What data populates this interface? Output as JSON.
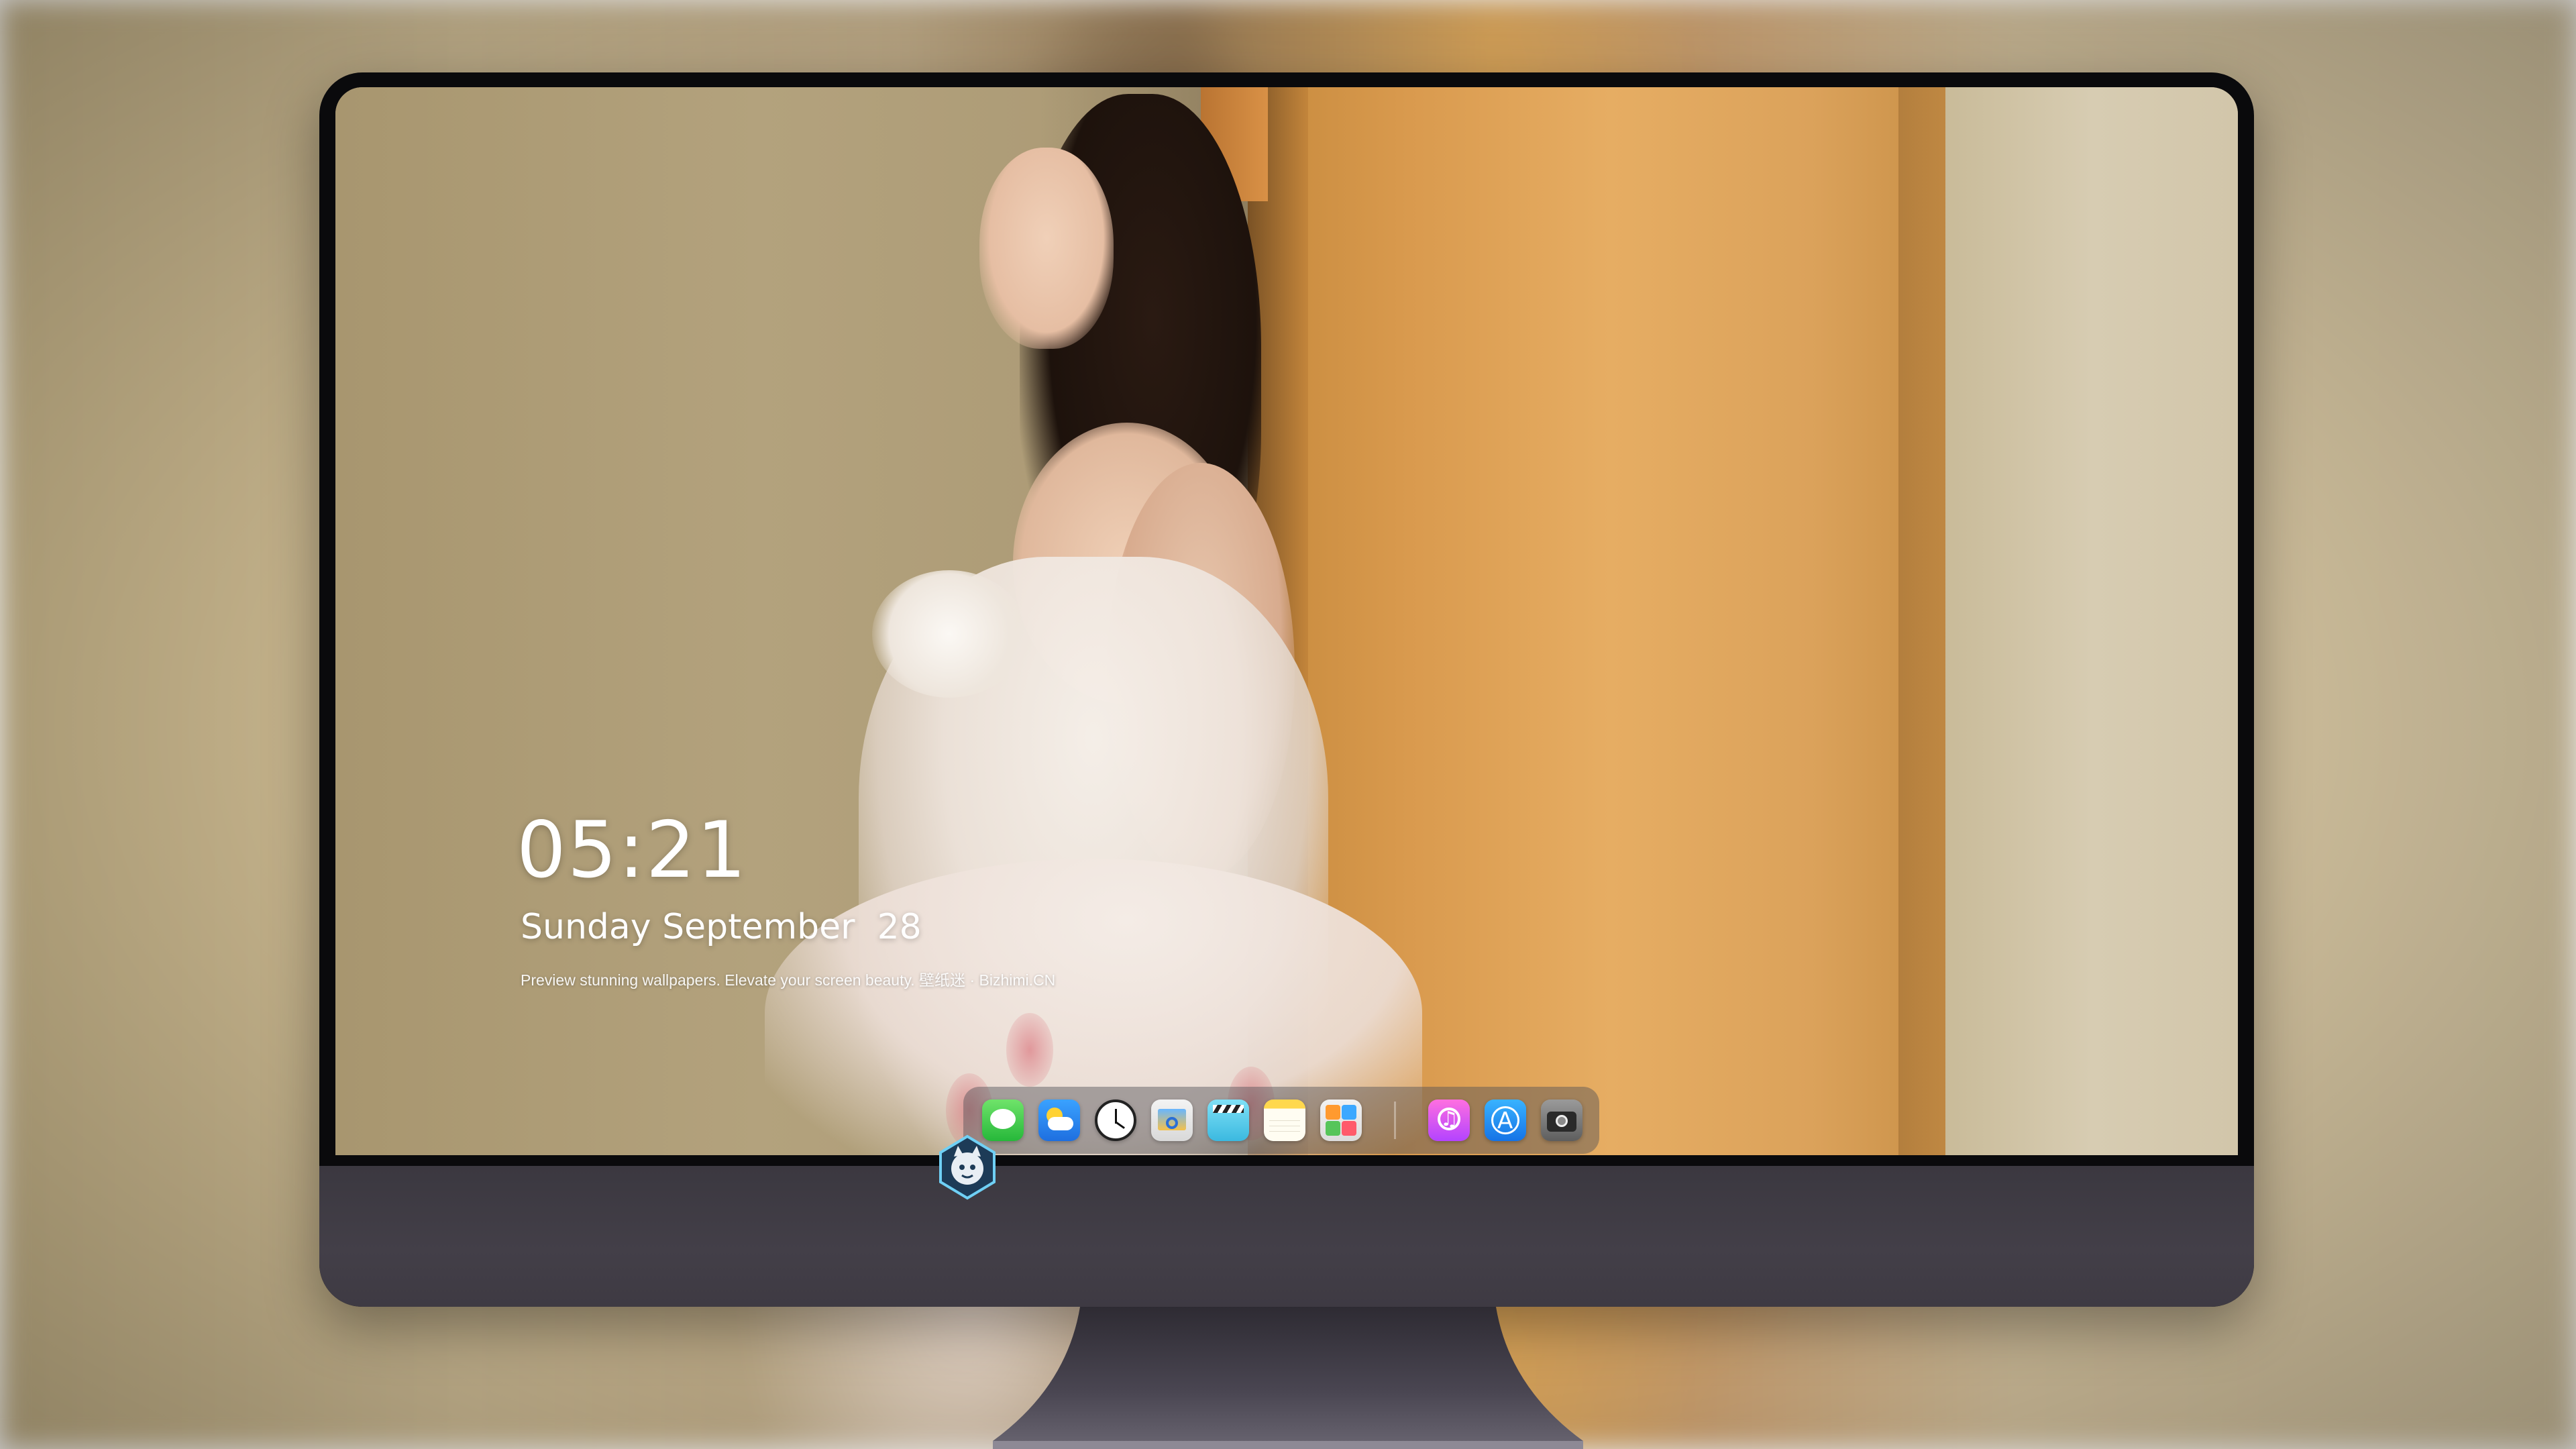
{
  "lockscreen": {
    "time": "05:21",
    "date": "Sunday September  28",
    "tagline": "Preview stunning wallpapers. Elevate your screen beauty. 壁纸迷 · Bizhimi.CN"
  },
  "dock": {
    "apps": [
      {
        "name": "messages",
        "icon": "messages-icon"
      },
      {
        "name": "weather",
        "icon": "weather-icon"
      },
      {
        "name": "clock",
        "icon": "clock-icon"
      },
      {
        "name": "preview",
        "icon": "preview-icon"
      },
      {
        "name": "video",
        "icon": "video-icon"
      },
      {
        "name": "notes",
        "icon": "notes-icon"
      },
      {
        "name": "photos",
        "icon": "photos-icon"
      },
      {
        "name": "music",
        "icon": "music-icon"
      },
      {
        "name": "app-store",
        "icon": "app-store-icon"
      },
      {
        "name": "camera",
        "icon": "camera-icon"
      }
    ]
  },
  "device": {
    "chin_logo": "mascot-logo-icon"
  },
  "colors": {
    "bezel": "#0a0a0c",
    "chin": "#433f48",
    "text": "#ffffff",
    "door_accent": "#e6ad63"
  }
}
